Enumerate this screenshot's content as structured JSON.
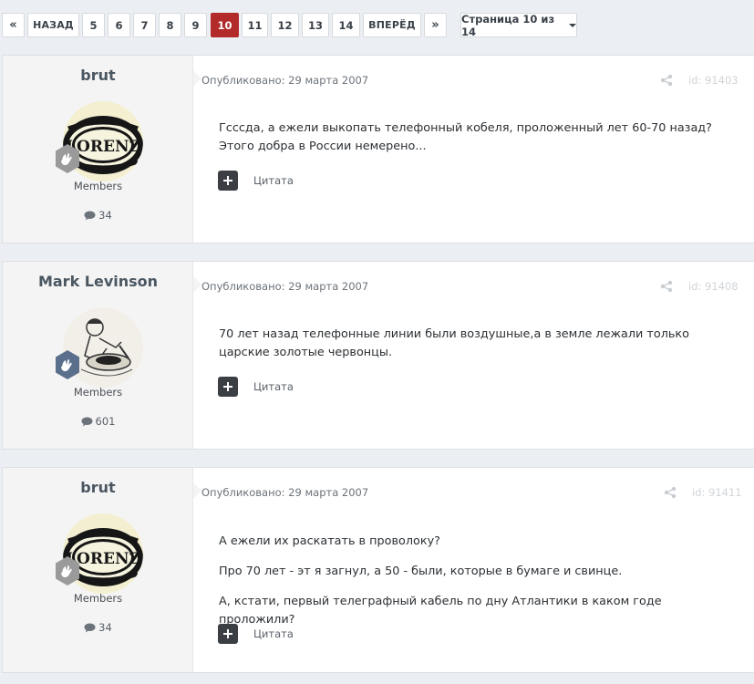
{
  "pagination": {
    "first": "«",
    "prev": "НАЗАД",
    "pages": [
      "5",
      "6",
      "7",
      "8",
      "9",
      "10",
      "11",
      "12",
      "13",
      "14"
    ],
    "active_page": "10",
    "next": "ВПЕРЁД",
    "last": "»",
    "page_select": "Страница 10 из 14"
  },
  "posts": [
    {
      "author": "brut",
      "avatar_text": "LORENZ",
      "group": "Members",
      "post_count": "34",
      "published": "Опубликовано: 29 марта 2007",
      "post_id": "id: 91403",
      "paragraphs": [
        "Гсссда, а ежели выкопать телефонный кобеля, проложенный лет 60-70 назад? Этого добра в России немерено..."
      ],
      "quote_label": "Цитата"
    },
    {
      "author": "Mark Levinson",
      "avatar_text": "",
      "group": "Members",
      "post_count": "601",
      "published": "Опубликовано: 29 марта 2007",
      "post_id": "id: 91408",
      "paragraphs": [
        "70 лет назад телефонные линии были воздушные,а в земле лежали только царские золотые червонцы."
      ],
      "quote_label": "Цитата"
    },
    {
      "author": "brut",
      "avatar_text": "LORENZ",
      "group": "Members",
      "post_count": "34",
      "published": "Опубликовано: 29 марта 2007",
      "post_id": "id: 91411",
      "paragraphs": [
        "А ежели их раскатать в проволоку?",
        "Про 70 лет - эт я загнул, а 50 - были, которые в бумаге и свинце.",
        "А, кстати, первый телеграфный кабель по дну Атлантики в каком годе проложили?"
      ],
      "quote_label": "Цитата"
    }
  ],
  "colors": {
    "active_page": "#b32a2a",
    "author_panel": "#f4f4f5",
    "rank_badge_bronze": "#9a9a9a",
    "rank_badge_blue": "#5a6f8c"
  },
  "icons": {
    "rank": "hand-badge-icon",
    "posts": "comment-icon",
    "share": "share-icon",
    "quote": "plus-icon"
  }
}
